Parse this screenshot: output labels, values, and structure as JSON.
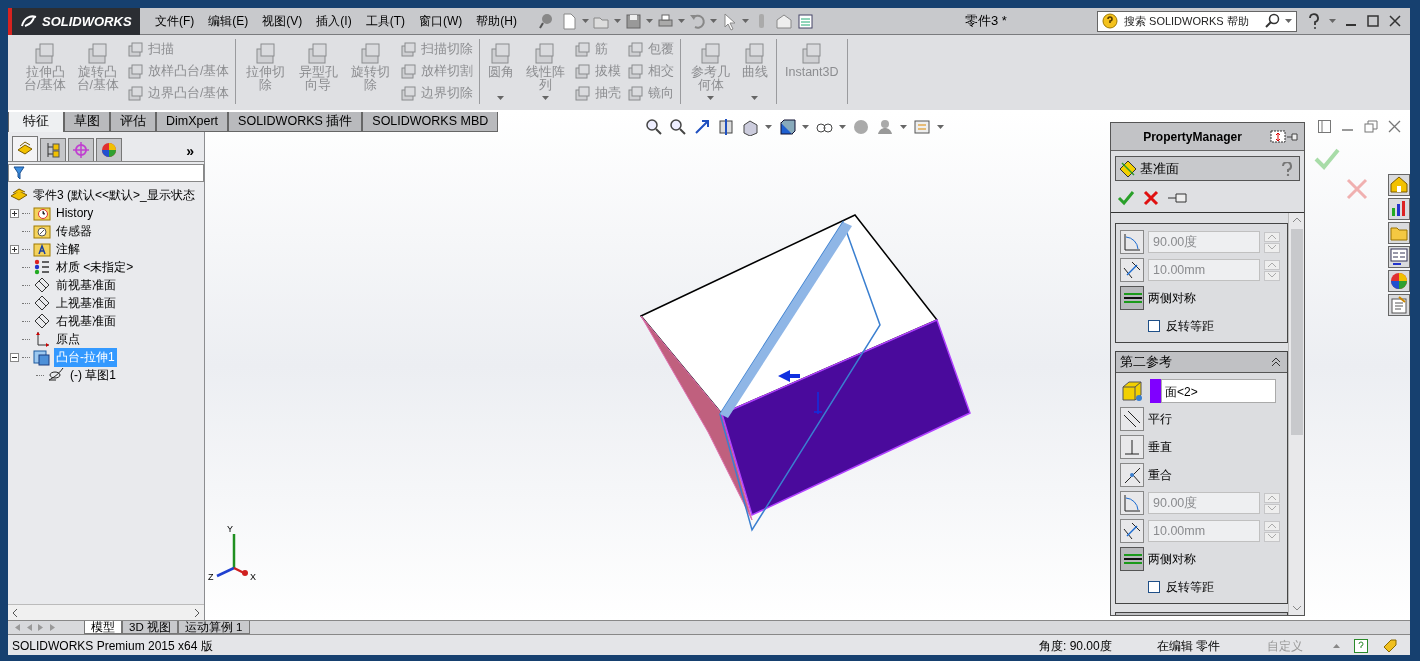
{
  "title_bar": {
    "logo": "SOLIDWORKS",
    "menu": [
      "文件(F)",
      "编辑(E)",
      "视图(V)",
      "插入(I)",
      "工具(T)",
      "窗口(W)",
      "帮助(H)"
    ],
    "document_title": "零件3 *",
    "search": {
      "placeholder": "搜索 SOLIDWORKS 帮助"
    }
  },
  "ribbon": {
    "groups": [
      {
        "items": [
          {
            "kind": "large",
            "label": "拉伸凸台/基体",
            "disabled": true,
            "has_menu": false
          },
          {
            "kind": "large",
            "label": "旋转凸台/基体",
            "disabled": true,
            "has_menu": false
          },
          {
            "kind": "stack",
            "items": [
              {
                "label": "扫描",
                "disabled": true
              },
              {
                "label": "放样凸台/基体",
                "disabled": true
              },
              {
                "label": "边界凸台/基体",
                "disabled": true
              }
            ]
          }
        ]
      },
      {
        "items": [
          {
            "kind": "large",
            "label": "拉伸切除",
            "disabled": true,
            "has_menu": false
          },
          {
            "kind": "large",
            "label": "异型孔向导",
            "disabled": true,
            "has_menu": false
          },
          {
            "kind": "large",
            "label": "旋转切除",
            "disabled": true,
            "has_menu": false
          },
          {
            "kind": "stack",
            "items": [
              {
                "label": "扫描切除",
                "disabled": true
              },
              {
                "label": "放样切割",
                "disabled": true
              },
              {
                "label": "边界切除",
                "disabled": true
              }
            ]
          }
        ]
      },
      {
        "items": [
          {
            "kind": "large",
            "label": "圆角",
            "disabled": true,
            "has_menu": true
          },
          {
            "kind": "large",
            "label": "线性阵列",
            "disabled": true,
            "has_menu": true
          },
          {
            "kind": "stack",
            "items": [
              {
                "label": "筋",
                "disabled": true
              },
              {
                "label": "拔模",
                "disabled": true
              },
              {
                "label": "抽壳",
                "disabled": true
              }
            ]
          },
          {
            "kind": "stack",
            "items": [
              {
                "label": "包覆",
                "disabled": true
              },
              {
                "label": "相交",
                "disabled": true
              },
              {
                "label": "镜向",
                "disabled": true
              }
            ]
          }
        ]
      },
      {
        "items": [
          {
            "kind": "large",
            "label": "参考几何体",
            "disabled": true,
            "has_menu": true
          },
          {
            "kind": "large",
            "label": "曲线",
            "disabled": true,
            "has_menu": true
          }
        ]
      },
      {
        "items": [
          {
            "kind": "large",
            "label": "Instant3D",
            "disabled": true,
            "has_menu": false
          }
        ]
      }
    ]
  },
  "command_tabs": [
    {
      "label": "特征",
      "selected": true
    },
    {
      "label": "草图",
      "selected": false
    },
    {
      "label": "评估",
      "selected": false
    },
    {
      "label": "DimXpert",
      "selected": false
    },
    {
      "label": "SOLIDWORKS 插件",
      "selected": false
    },
    {
      "label": "SOLIDWORKS MBD",
      "selected": false
    }
  ],
  "feature_manager": {
    "tabs": [
      {
        "kind": "features",
        "selected": true
      },
      {
        "kind": "properties",
        "selected": false
      },
      {
        "kind": "configurations",
        "selected": false
      },
      {
        "kind": "display",
        "selected": false
      }
    ],
    "more": "»",
    "tree": {
      "label": "零件3  (默认<<默认>_显示状态",
      "kind": "part",
      "selected": false,
      "children": [
        {
          "label": "History",
          "kind": "history",
          "has_children": true,
          "expanded": false,
          "selected": false
        },
        {
          "label": "传感器",
          "kind": "sensors",
          "has_children": false,
          "selected": false
        },
        {
          "label": "注解",
          "kind": "annotations",
          "has_children": true,
          "expanded": false,
          "selected": false
        },
        {
          "label": "材质 <未指定>",
          "kind": "material",
          "has_children": false,
          "selected": false
        },
        {
          "label": "前视基准面",
          "kind": "plane",
          "has_children": false,
          "selected": false
        },
        {
          "label": "上视基准面",
          "kind": "plane",
          "has_children": false,
          "selected": false
        },
        {
          "label": "右视基准面",
          "kind": "plane",
          "has_children": false,
          "selected": false
        },
        {
          "label": "原点",
          "kind": "origin",
          "has_children": false,
          "selected": false
        },
        {
          "label": "凸台-拉伸1",
          "kind": "feature",
          "has_children": true,
          "expanded": true,
          "selected": true,
          "children": [
            {
              "label": "(-) 草图1",
              "kind": "sketch",
              "has_children": false,
              "selected": false
            }
          ]
        }
      ]
    }
  },
  "viewport": {
    "triad": {
      "y": "Y",
      "z": "Z",
      "x": "X"
    }
  },
  "property_manager": {
    "header": "PropertyManager",
    "feature_title": "基准面",
    "sections": [
      {
        "rows": [
          {
            "kind": "angle",
            "value": "90.00度",
            "disabled": true
          },
          {
            "kind": "distance",
            "value": "10.00mm",
            "disabled": true
          },
          {
            "kind": "toggle",
            "label": "两侧对称",
            "on": true
          },
          {
            "kind": "checkbox",
            "label": "反转等距",
            "checked": false
          }
        ]
      },
      {
        "title": "第二参考",
        "expanded": true,
        "rows": [
          {
            "kind": "selection",
            "value": "面<2>",
            "color": "#8000ff"
          },
          {
            "kind": "constraint",
            "label": "平行",
            "on": false
          },
          {
            "kind": "constraint",
            "label": "垂直",
            "on": false
          },
          {
            "kind": "constraint",
            "label": "重合",
            "on": false
          },
          {
            "kind": "angle",
            "value": "90.00度",
            "disabled": true
          },
          {
            "kind": "distance",
            "value": "10.00mm",
            "disabled": true
          },
          {
            "kind": "toggle",
            "label": "两侧对称",
            "on": true
          },
          {
            "kind": "checkbox",
            "label": "反转等距",
            "checked": false
          }
        ]
      }
    ]
  },
  "bottom_tabs": [
    {
      "label": "模型",
      "selected": true
    },
    {
      "label": "3D 视图",
      "selected": false
    },
    {
      "label": "运动算例 1",
      "selected": false
    }
  ],
  "status_bar": {
    "product": "SOLIDWORKS Premium 2015 x64 版",
    "reading": "角度: 90.00度",
    "mode": "在编辑 零件",
    "units": "自定义"
  }
}
